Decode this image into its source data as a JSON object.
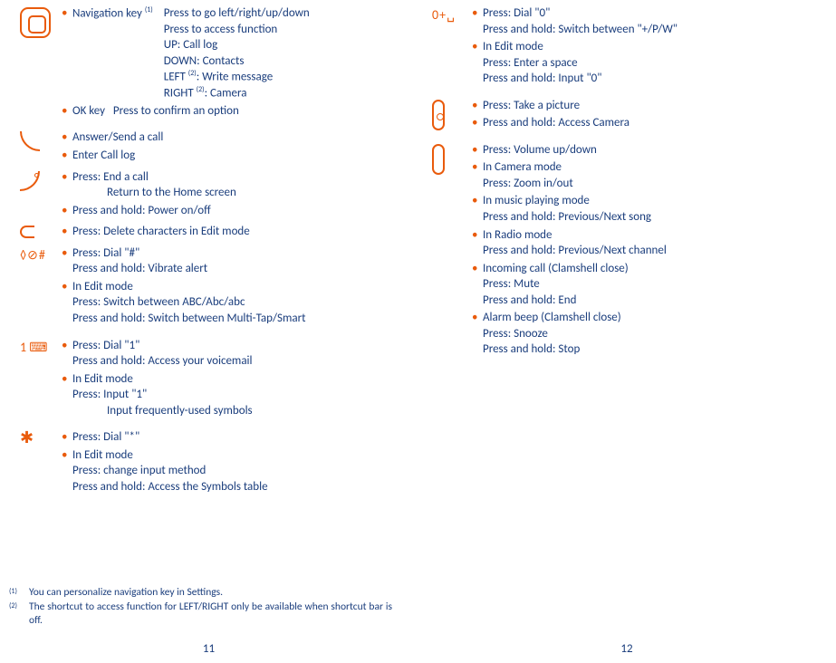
{
  "left": {
    "nav": {
      "label": "Navigation key",
      "fn": "(1)",
      "lines": [
        "Press to go left/right/up/down",
        "Press to access function",
        "UP: Call log",
        "DOWN: Contacts"
      ],
      "left_line_prefix": "LEFT ",
      "left_line_suffix": ": Write message",
      "right_line_prefix": "RIGHT ",
      "right_line_suffix": ": Camera",
      "fn2": "(2)"
    },
    "ok": {
      "label": "OK key",
      "desc": "Press to confirm an option"
    },
    "answer": [
      "Answer/Send a call",
      "Enter Call log"
    ],
    "end": {
      "a": [
        "Press: End a call",
        "Return to the Home screen"
      ],
      "b": "Press and hold: Power on/off"
    },
    "delete": "Press: Delete characters in Edit mode",
    "hash": {
      "a": [
        "Press: Dial \"#\"",
        "Press and hold: Vibrate alert"
      ],
      "b": [
        "In Edit mode",
        "Press: Switch between ABC/Abc/abc",
        "Press and hold: Switch between Multi-Tap/Smart"
      ]
    },
    "one": {
      "a": [
        "Press: Dial \"1\"",
        "Press and hold: Access your voicemail"
      ],
      "b": [
        "In Edit mode",
        "Press: Input \"1\""
      ],
      "b_extra": "Input frequently-used symbols"
    },
    "star": {
      "a": "Press: Dial \"*\"",
      "b": [
        "In Edit mode",
        "Press: change input method",
        "Press and hold: Access the Symbols table"
      ]
    },
    "footnotes": {
      "f1": "You can personalize navigation key in Settings.",
      "f2": "The shortcut to access function for LEFT/RIGHT only be available when shortcut bar is off."
    },
    "page": "11"
  },
  "right": {
    "zero": {
      "a": [
        "Press: Dial \"0\"",
        "Press and hold: Switch between \"+/P/W\""
      ],
      "b": [
        "In Edit mode",
        "Press: Enter a space",
        "Press and hold: Input \"0\""
      ]
    },
    "camera": [
      "Press: Take a picture",
      "Press and hold: Access Camera"
    ],
    "volume": [
      "Press: Volume up/down",
      [
        "In Camera mode",
        "Press: Zoom in/out"
      ],
      [
        "In music playing mode",
        "Press and hold: Previous/Next song"
      ],
      [
        "In Radio mode",
        "Press and hold: Previous/Next channel"
      ],
      [
        "Incoming call (Clamshell close)",
        "Press: Mute",
        "Press and hold: End"
      ],
      [
        "Alarm beep (Clamshell close)",
        "Press: Snooze",
        "Press and hold: Stop"
      ]
    ],
    "page": "12"
  }
}
